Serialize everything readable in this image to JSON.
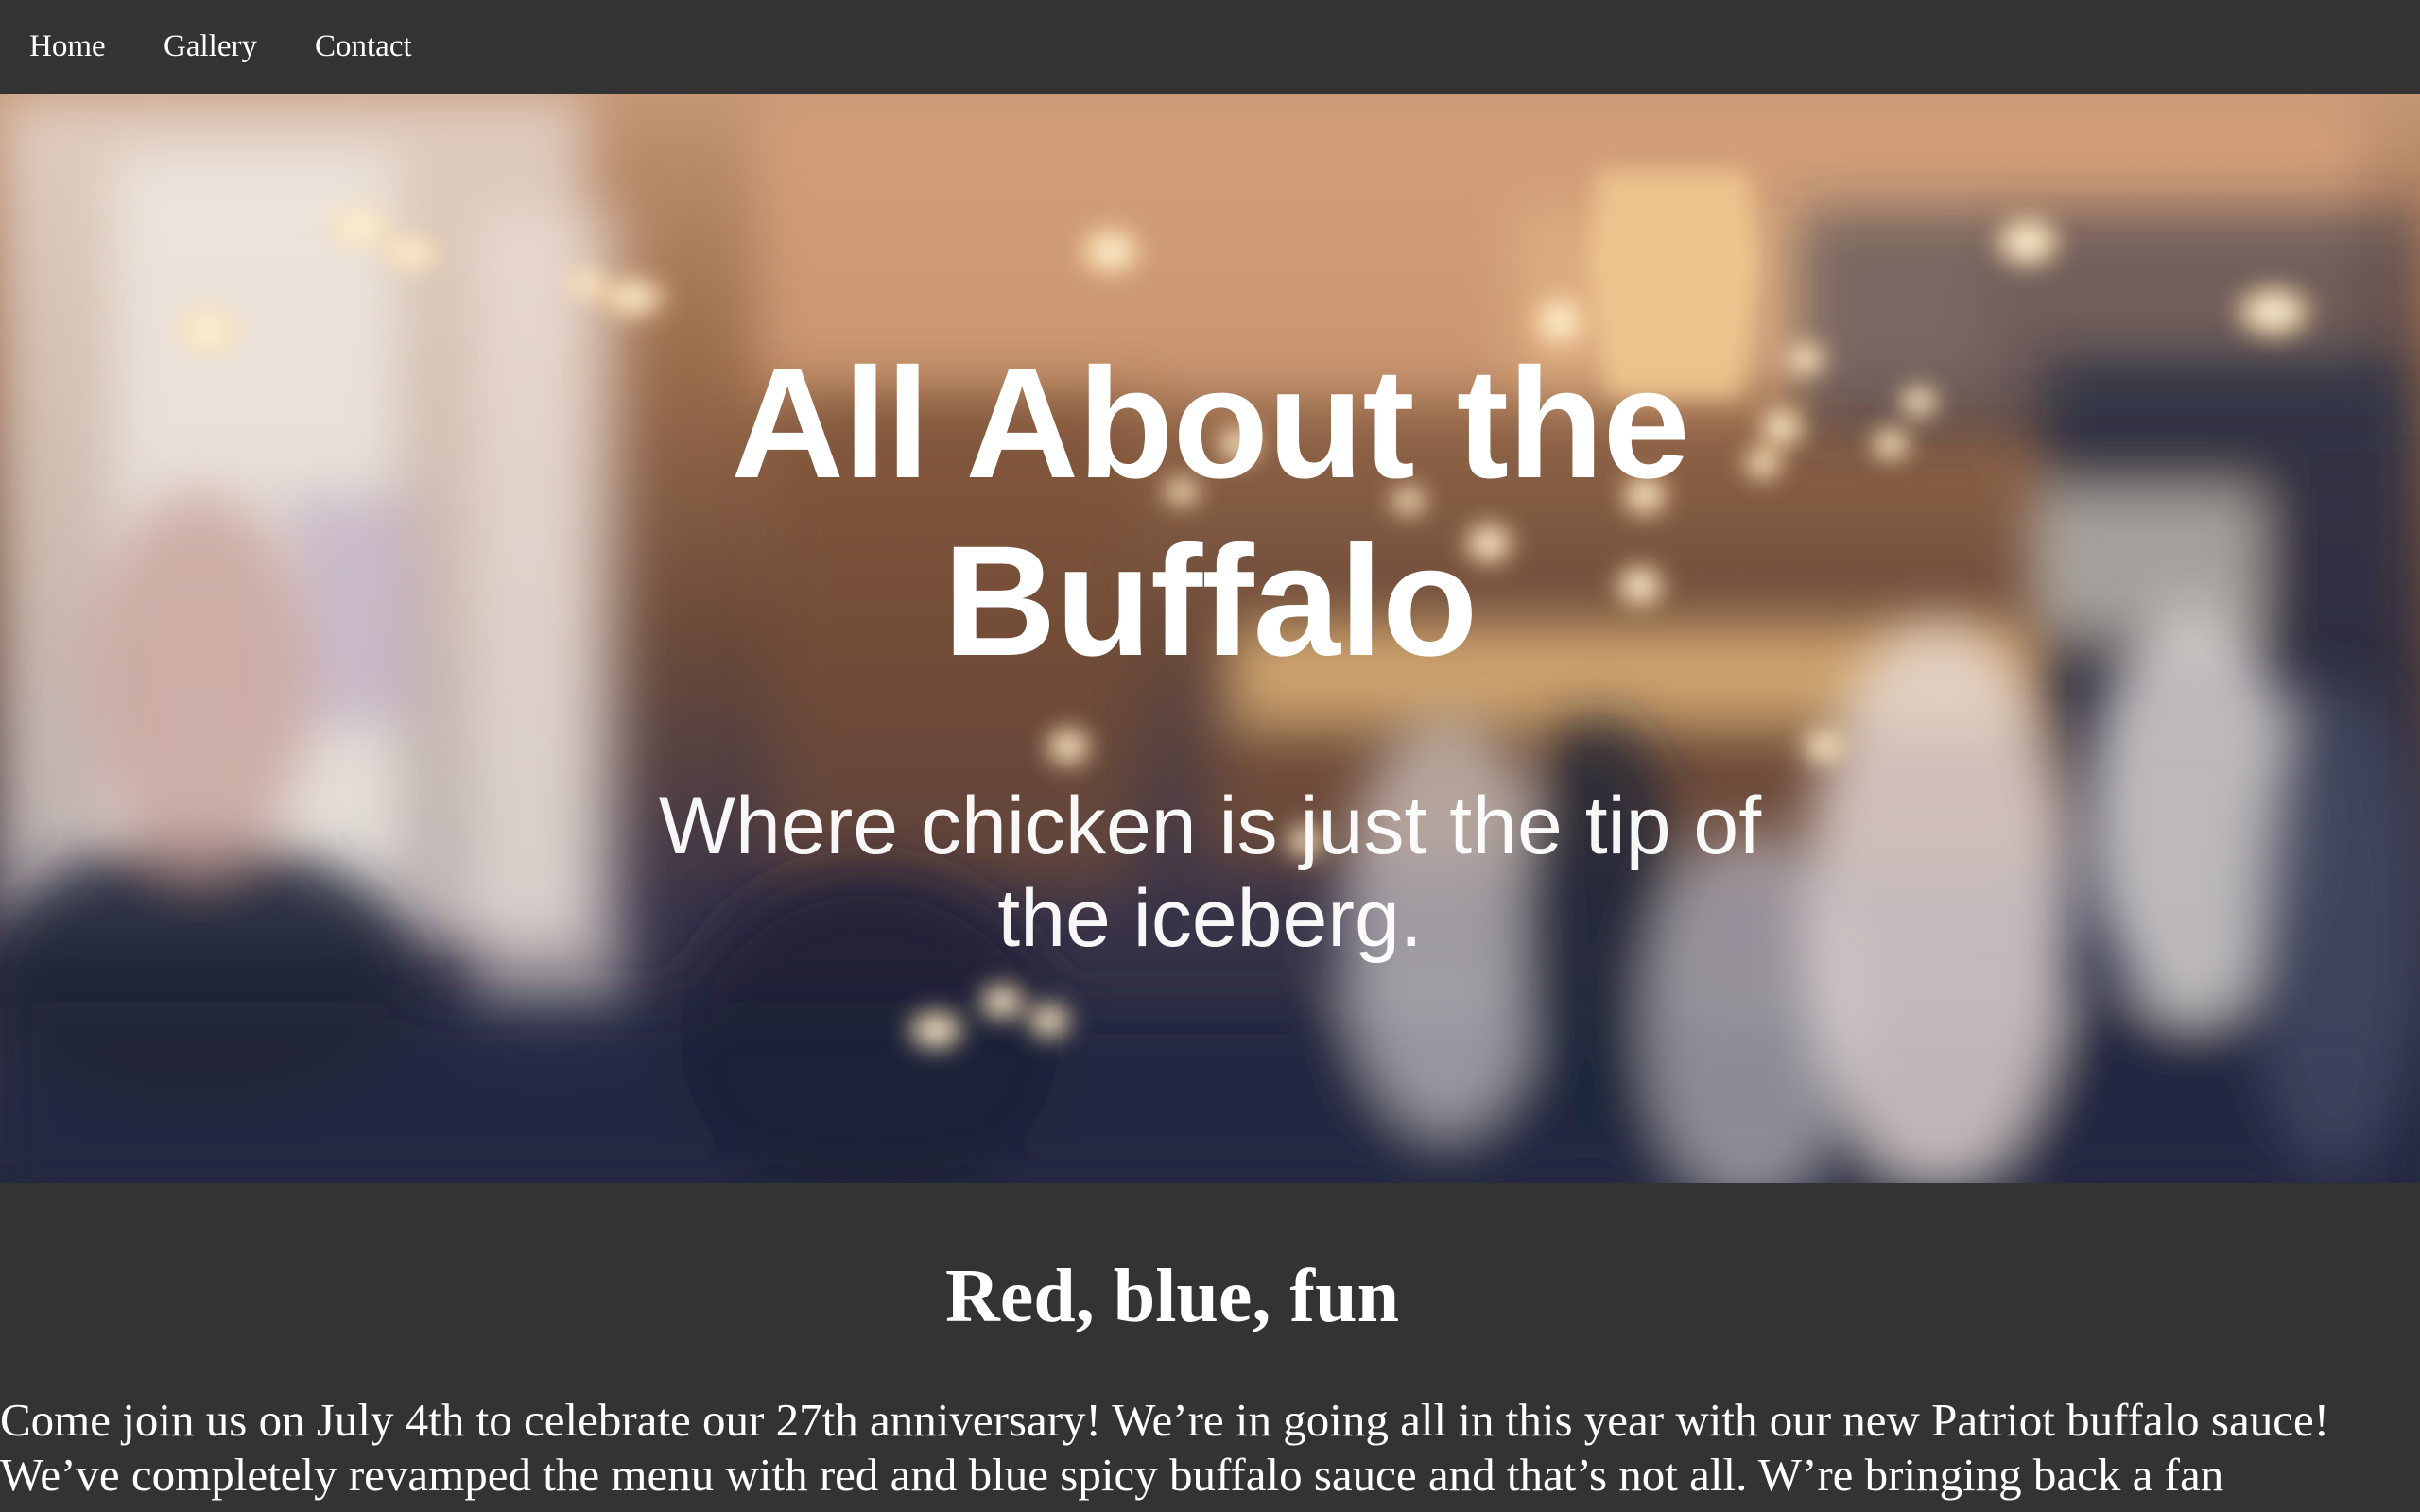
{
  "colors": {
    "background": "#333333",
    "nav_background": "#333333",
    "text": "#ffffff"
  },
  "nav": {
    "items": [
      {
        "label": "Home"
      },
      {
        "label": "Gallery"
      },
      {
        "label": "Contact"
      }
    ]
  },
  "hero": {
    "background_image": "blurred-restaurant-interior",
    "title": "All About the Buffalo",
    "subtitle": "Where chicken is just the tip of the iceberg."
  },
  "section": {
    "heading": "Red, blue, fun",
    "body": "Come join us on July 4th to celebrate our 27th anniversary! We’re in going all in this year with our new Patriot buffalo sauce! We’ve completely revamped the menu with red and blue spicy buffalo sauce and that’s not all. W’re bringing back a fan"
  }
}
